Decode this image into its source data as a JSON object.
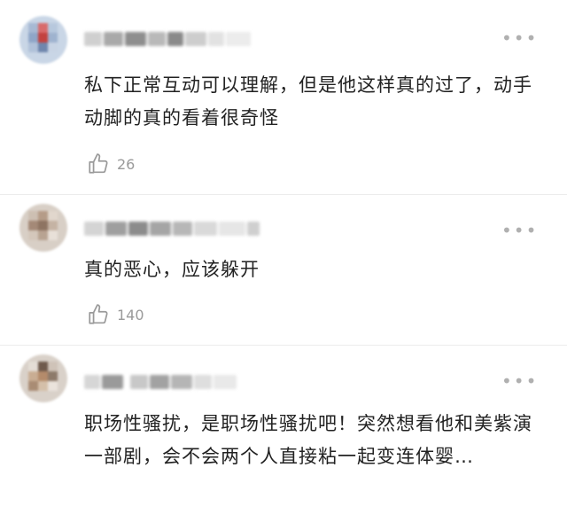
{
  "comments": [
    {
      "text": "私下正常互动可以理解，但是他这样真的过了，动手动脚的真的看着很奇怪",
      "likes": "26",
      "more_icon": "more-dots-icon",
      "like_icon": "thumb-up-icon"
    },
    {
      "text": "真的恶心，应该躲开",
      "likes": "140",
      "more_icon": "more-dots-icon",
      "like_icon": "thumb-up-icon"
    },
    {
      "text": "职场性骚扰，是职场性骚扰吧！突然想看他和美紫演一部剧，会不会两个人直接粘一起变连体婴…",
      "more_icon": "more-dots-icon"
    }
  ],
  "colors": {
    "text": "#222222",
    "meta": "#9a9a9a",
    "divider": "#ececec"
  }
}
